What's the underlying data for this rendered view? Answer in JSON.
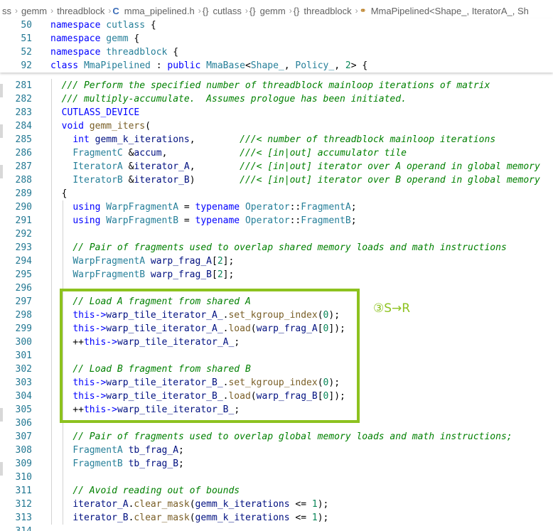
{
  "breadcrumb": {
    "items": [
      "ss",
      "gemm",
      "threadblock"
    ],
    "file": "mma_pipelined.h",
    "scopes": [
      "cutlass",
      "gemm",
      "threadblock"
    ],
    "class_crumb": "MmaPipelined<Shape_, IteratorA_, Sh"
  },
  "sticky": [
    {
      "n": "50",
      "t": "namespace cutlass {"
    },
    {
      "n": "51",
      "t": "namespace gemm {"
    },
    {
      "n": "52",
      "t": "namespace threadblock {"
    },
    {
      "n": "92",
      "t": "class MmaPipelined : public MmaBase<Shape_, Policy_, 2> {"
    }
  ],
  "partial_line_top": "280",
  "lines": [
    {
      "n": "281",
      "t": "  /// Perform the specified number of threadblock mainloop iterations of matrix"
    },
    {
      "n": "282",
      "t": "  /// multiply-accumulate.  Assumes prologue has been initiated."
    },
    {
      "n": "283",
      "t": "  CUTLASS_DEVICE"
    },
    {
      "n": "284",
      "t": "  void gemm_iters("
    },
    {
      "n": "285",
      "t": "    int gemm_k_iterations,        ///< number of threadblock mainloop iterations"
    },
    {
      "n": "286",
      "t": "    FragmentC &accum,             ///< [in|out] accumulator tile"
    },
    {
      "n": "287",
      "t": "    IteratorA &iterator_A,        ///< [in|out] iterator over A operand in global memory"
    },
    {
      "n": "288",
      "t": "    IteratorB &iterator_B)        ///< [in|out] iterator over B operand in global memory"
    },
    {
      "n": "289",
      "t": "  {"
    },
    {
      "n": "290",
      "t": "    using WarpFragmentA = typename Operator::FragmentA;"
    },
    {
      "n": "291",
      "t": "    using WarpFragmentB = typename Operator::FragmentB;"
    },
    {
      "n": "292",
      "t": ""
    },
    {
      "n": "293",
      "t": "    // Pair of fragments used to overlap shared memory loads and math instructions"
    },
    {
      "n": "294",
      "t": "    WarpFragmentA warp_frag_A[2];"
    },
    {
      "n": "295",
      "t": "    WarpFragmentB warp_frag_B[2];"
    },
    {
      "n": "296",
      "t": ""
    },
    {
      "n": "297",
      "t": "    // Load A fragment from shared A"
    },
    {
      "n": "298",
      "t": "    this->warp_tile_iterator_A_.set_kgroup_index(0);"
    },
    {
      "n": "299",
      "t": "    this->warp_tile_iterator_A_.load(warp_frag_A[0]);"
    },
    {
      "n": "300",
      "t": "    ++this->warp_tile_iterator_A_;"
    },
    {
      "n": "301",
      "t": ""
    },
    {
      "n": "302",
      "t": "    // Load B fragment from shared B"
    },
    {
      "n": "303",
      "t": "    this->warp_tile_iterator_B_.set_kgroup_index(0);"
    },
    {
      "n": "304",
      "t": "    this->warp_tile_iterator_B_.load(warp_frag_B[0]);"
    },
    {
      "n": "305",
      "t": "    ++this->warp_tile_iterator_B_;"
    },
    {
      "n": "306",
      "t": ""
    },
    {
      "n": "307",
      "t": "    // Pair of fragments used to overlap global memory loads and math instructions;"
    },
    {
      "n": "308",
      "t": "    FragmentA tb_frag_A;"
    },
    {
      "n": "309",
      "t": "    FragmentB tb_frag_B;"
    },
    {
      "n": "310",
      "t": ""
    },
    {
      "n": "311",
      "t": "    // Avoid reading out of bounds"
    },
    {
      "n": "312",
      "t": "    iterator_A.clear_mask(gemm_k_iterations <= 1);"
    },
    {
      "n": "313",
      "t": "    iterator_B.clear_mask(gemm_k_iterations <= 1);"
    }
  ],
  "partial_line_bottom": "314",
  "annotation": "③S→R",
  "colors": {
    "highlight": "#8dc21f",
    "line_number": "#237893",
    "keyword": "#0000ff",
    "type": "#267f99",
    "function": "#795e26",
    "comment": "#008000",
    "number": "#098658"
  }
}
